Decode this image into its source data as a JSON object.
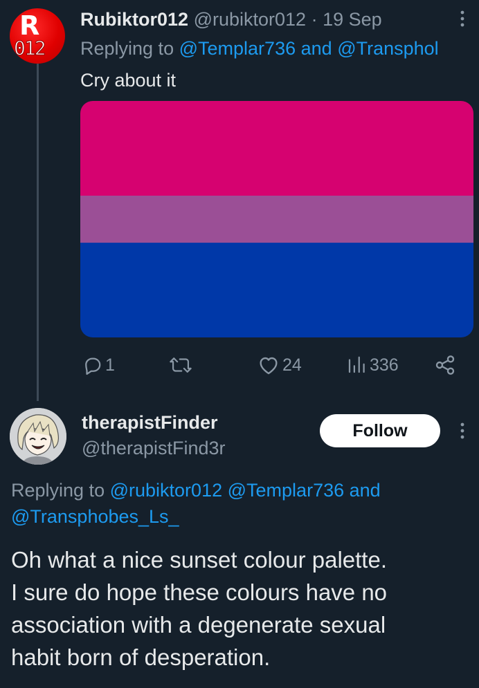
{
  "tweet1": {
    "display_name": "Rubiktor012",
    "handle": "@rubiktor012",
    "dot": "·",
    "date": "19 Sep",
    "avatar_letter": "R",
    "avatar_number": "012",
    "reply_prefix": "Replying to",
    "reply_mention_1": "@Templar736",
    "reply_and": "and",
    "reply_mention_2": "@Transphol",
    "text": "Cry about it",
    "flag_colors": [
      "#d60270",
      "#9b4f96",
      "#0038a8"
    ],
    "flag_ratios": [
      0.4,
      0.2,
      0.4
    ],
    "actions": {
      "reply_count": "1",
      "retweet_count": "",
      "like_count": "24",
      "views_count": "336"
    },
    "icons": [
      "reply-icon",
      "retweet-icon",
      "like-icon",
      "views-icon",
      "share-icon",
      "more-icon"
    ]
  },
  "tweet2": {
    "display_name": "therapistFinder",
    "handle": "@therapistFind3r",
    "follow_label": "Follow",
    "reply_prefix": "Replying to",
    "reply_mention_1": "@rubiktor012",
    "reply_mention_2": "@Templar736",
    "reply_and": "and",
    "reply_mention_3": "@Transphobes_Ls_",
    "text_lines": [
      "Oh what a nice sunset colour palette.",
      "I sure do hope these colours have no",
      "association with a degenerate sexual",
      "habit born of desperation."
    ]
  },
  "colors": {
    "background": "#15202b",
    "text_primary": "#e7e9ea",
    "text_secondary": "#8b98a5",
    "link": "#1d9bf0",
    "thread_line": "#3d4a57"
  }
}
